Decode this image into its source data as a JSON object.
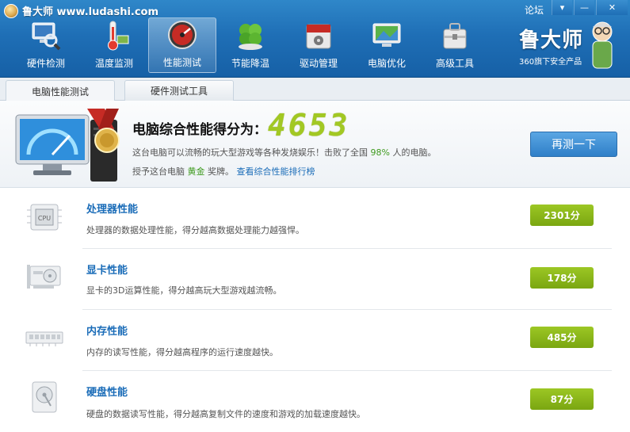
{
  "window": {
    "title": "鲁大师 www.ludashi.com",
    "forum_label": "论坛",
    "menu_glyph": "▾",
    "minimize_glyph": "—",
    "close_glyph": "✕"
  },
  "nav": [
    {
      "label": "硬件检测",
      "icon": "magnifier-monitor-icon"
    },
    {
      "label": "温度监测",
      "icon": "thermometer-icon"
    },
    {
      "label": "性能测试",
      "icon": "speed-gauge-icon",
      "active": true
    },
    {
      "label": "节能降温",
      "icon": "clover-leaf-icon"
    },
    {
      "label": "驱动管理",
      "icon": "driver-box-icon"
    },
    {
      "label": "电脑优化",
      "icon": "optimize-screen-icon"
    },
    {
      "label": "高级工具",
      "icon": "toolbox-icon"
    }
  ],
  "brand": {
    "logo_text": "鲁大师",
    "subtitle": "360旗下安全产品"
  },
  "tabs": [
    {
      "label": "电脑性能测试",
      "active": true
    },
    {
      "label": "硬件测试工具",
      "active": false
    }
  ],
  "score": {
    "label": "电脑综合性能得分为：",
    "value": "4653",
    "desc_prefix": "这台电脑可以流畅的玩大型游戏等各种发烧娱乐！击败了全国",
    "beat_percent": "98%",
    "desc_suffix": "人的电脑。",
    "award_prefix": "授予这台电脑",
    "award_level": "黄金",
    "award_suffix": "奖牌。",
    "ranking_link": "查看综合性能排行榜",
    "retest_button": "再测一下"
  },
  "items": [
    {
      "title": "处理器性能",
      "desc": "处理器的数据处理性能，得分越高数据处理能力越强悍。",
      "score": "2301分",
      "icon": "cpu-chip-icon"
    },
    {
      "title": "显卡性能",
      "desc": "显卡的3D运算性能，得分越高玩大型游戏越流畅。",
      "score": "178分",
      "icon": "graphics-card-icon"
    },
    {
      "title": "内存性能",
      "desc": "内存的读写性能，得分越高程序的运行速度越快。",
      "score": "485分",
      "icon": "memory-stick-icon"
    },
    {
      "title": "硬盘性能",
      "desc": "硬盘的数据读写性能，得分越高复制文件的速度和游戏的加载速度越快。",
      "score": "87分",
      "icon": "hard-disk-icon"
    }
  ],
  "colors": {
    "header": "#1f6fb6",
    "score_green": "#a2c823",
    "badge_green": "#8ab61a",
    "link_blue": "#1a6cb8"
  }
}
